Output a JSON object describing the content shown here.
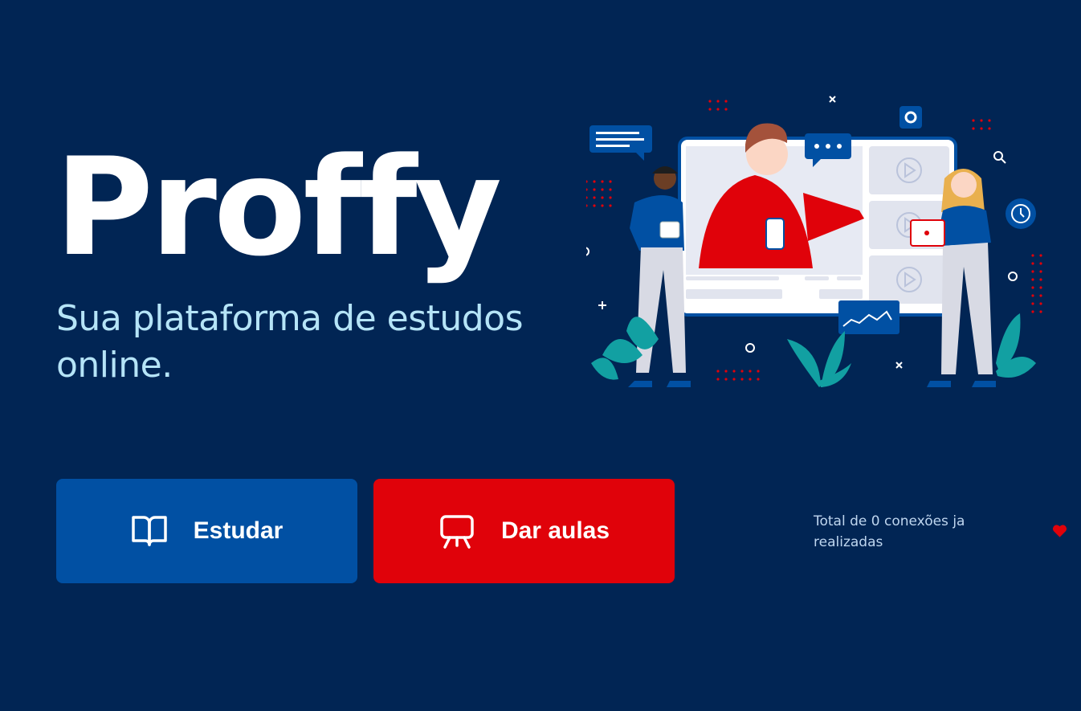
{
  "brand": {
    "name": "Proffy"
  },
  "tagline": "Sua plataforma de estudos online.",
  "actions": {
    "study_label": "Estudar",
    "teach_label": "Dar aulas"
  },
  "footer": {
    "connections_text": "Total de 0 conexões ja realizadas"
  },
  "icons": {
    "study": "book-open-icon",
    "teach": "presentation-board-icon",
    "connections": "heart-icon"
  },
  "colors": {
    "background": "#012554",
    "study_button": "#0150A3",
    "teach_button": "#E0020A",
    "tagline": "#B5E4F7",
    "heart": "#E0020A"
  }
}
